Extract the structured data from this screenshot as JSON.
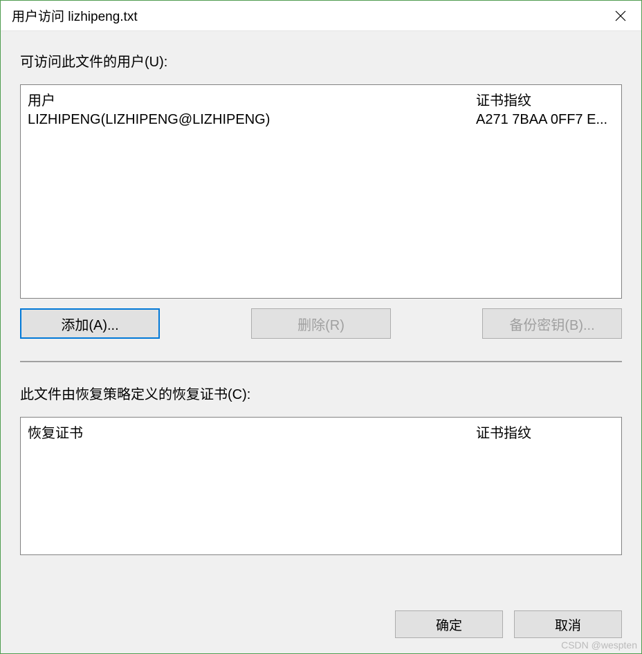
{
  "window": {
    "title": "用户访问 lizhipeng.txt"
  },
  "users_section": {
    "label": "可访问此文件的用户(U):",
    "columns": {
      "user": "用户",
      "thumbprint": "证书指纹"
    },
    "rows": [
      {
        "user": "LIZHIPENG(LIZHIPENG@LIZHIPENG)",
        "thumbprint": "A271 7BAA 0FF7 E..."
      }
    ]
  },
  "user_buttons": {
    "add": "添加(A)...",
    "remove": "删除(R)",
    "backup": "备份密钥(B)..."
  },
  "recovery_section": {
    "label": "此文件由恢复策略定义的恢复证书(C):",
    "columns": {
      "cert": "恢复证书",
      "thumbprint": "证书指纹"
    }
  },
  "dialog_buttons": {
    "ok": "确定",
    "cancel": "取消"
  },
  "watermark": "CSDN @wespten"
}
